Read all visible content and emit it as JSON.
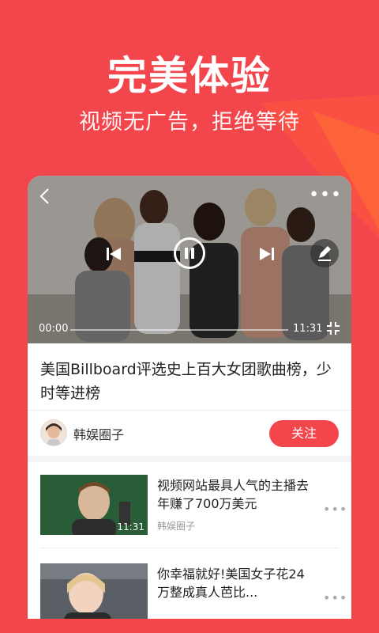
{
  "promo": {
    "headline": "完美体验",
    "subline": "视频无广告，拒绝等待"
  },
  "colors": {
    "brand": "#f2464c",
    "text": "#222222",
    "muted": "#999999"
  },
  "player": {
    "current_time": "00:00",
    "total_time": "11:31",
    "progress": 0.0,
    "icons": [
      "back-icon",
      "more-icon",
      "prev-icon",
      "pause-icon",
      "next-icon",
      "edit-icon",
      "fullscreen-icon"
    ]
  },
  "video": {
    "title": "美国Billboard评选史上百大女团歌曲榜，少时等进榜"
  },
  "author": {
    "name": "韩娱圈子",
    "follow_label": "关注"
  },
  "list": [
    {
      "title": "视频网站最具人气的主播去年赚了700万美元",
      "source": "韩娱圈子",
      "duration": "11:31"
    },
    {
      "title": "你幸福就好!美国女子花24万整成真人芭比...",
      "source": "",
      "duration": ""
    }
  ]
}
